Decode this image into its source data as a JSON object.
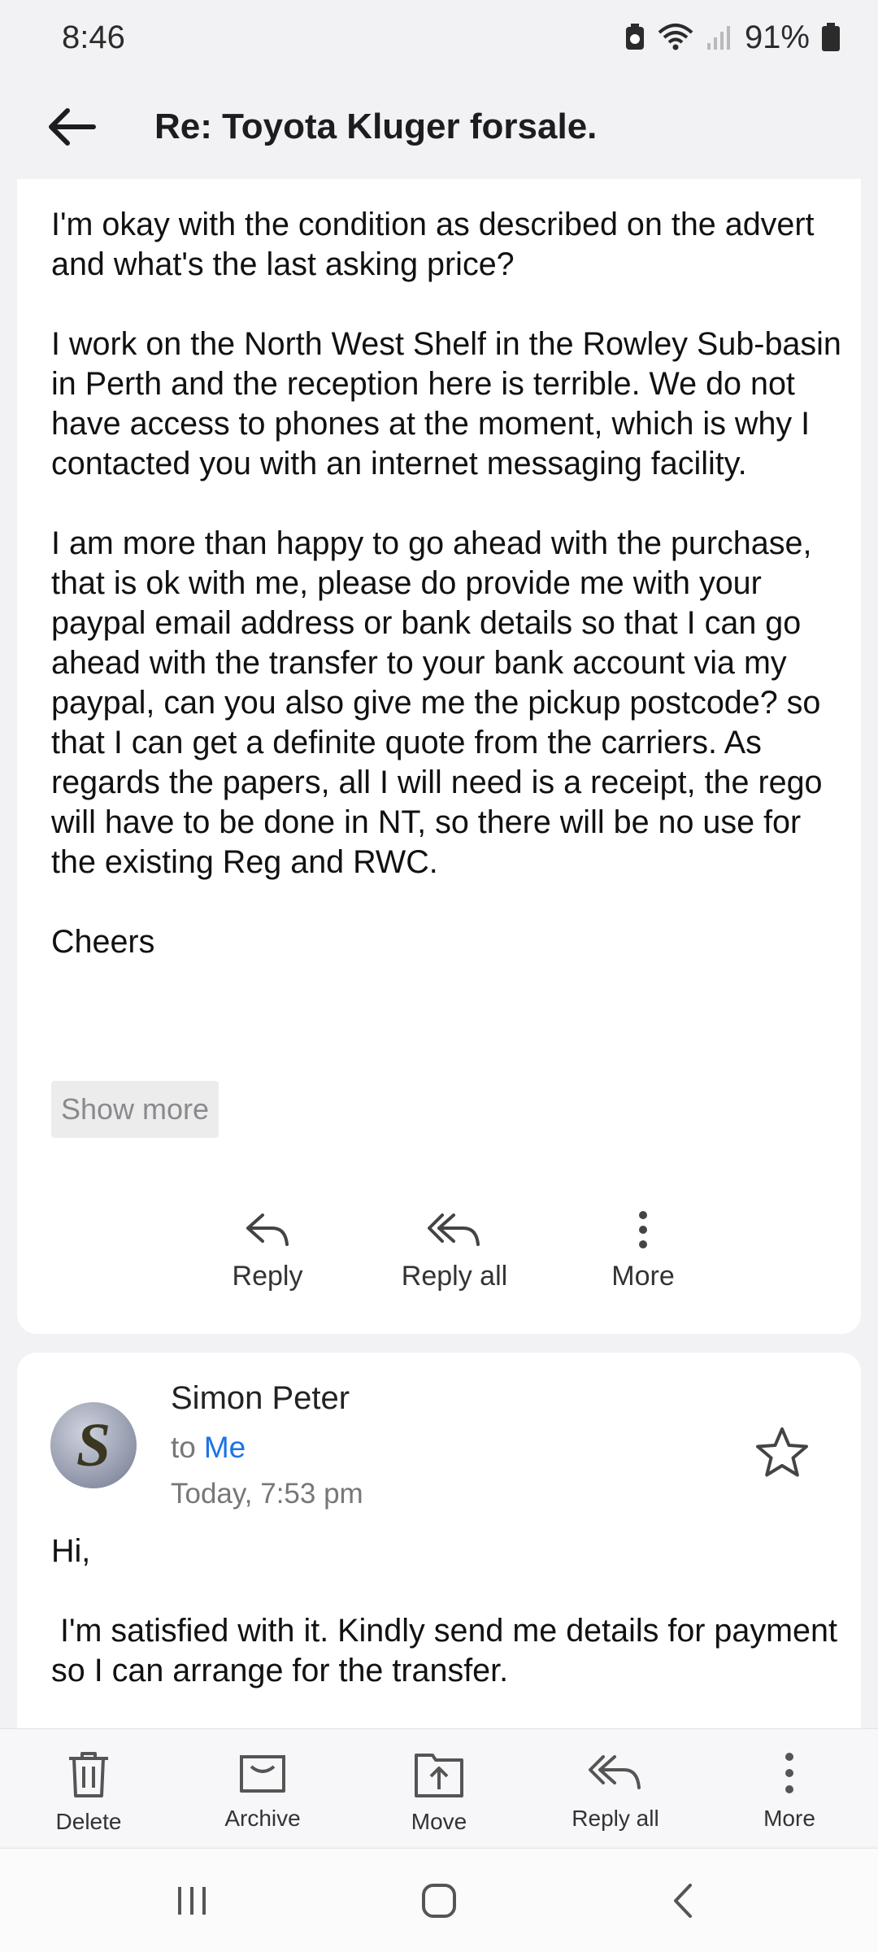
{
  "status_bar": {
    "time": "8:46",
    "battery": "91%"
  },
  "app_bar": {
    "subject": "Re: Toyota Kluger forsale."
  },
  "message1": {
    "paragraphs": [
      "I'm okay with the condition as described on the advert and what's the last asking price?",
      "I work on the North West Shelf in the Rowley Sub-basin in Perth and the reception here is terrible. We do not have access to phones at the moment, which is why I contacted you with an internet messaging facility.",
      "I am more than happy to go ahead with the purchase, that is ok with me, please do provide me with your paypal email address or bank details so that I can go ahead with the transfer to your bank account via my paypal, can you also give me the pickup postcode? so that I can get a definite quote from the carriers. As regards the papers, all I will need is a receipt, the rego will have to be done in NT, so there will be no use for the existing Reg and RWC.",
      "Cheers"
    ],
    "show_more_label": "Show more",
    "actions": {
      "reply": "Reply",
      "reply_all": "Reply all",
      "more": "More"
    }
  },
  "message2": {
    "avatar_letter": "S",
    "sender": "Simon Peter",
    "to_prefix": "to",
    "to_name": "Me",
    "date": "Today, 7:53 pm",
    "greeting": "Hi,",
    "body": " I'm satisfied with it. Kindly send me details for payment so I can arrange for the transfer."
  },
  "toolbar": {
    "delete": "Delete",
    "archive": "Archive",
    "move": "Move",
    "reply_all": "Reply all",
    "more": "More"
  },
  "colors": {
    "accent": "#1a73e8",
    "background": "#f2f2f4",
    "card": "#ffffff"
  },
  "icons": [
    "back-arrow-icon",
    "reply-icon",
    "reply-all-icon",
    "more-vertical-icon",
    "star-icon",
    "delete-icon",
    "archive-icon",
    "move-icon",
    "recents-icon",
    "home-icon",
    "back-nav-icon"
  ]
}
